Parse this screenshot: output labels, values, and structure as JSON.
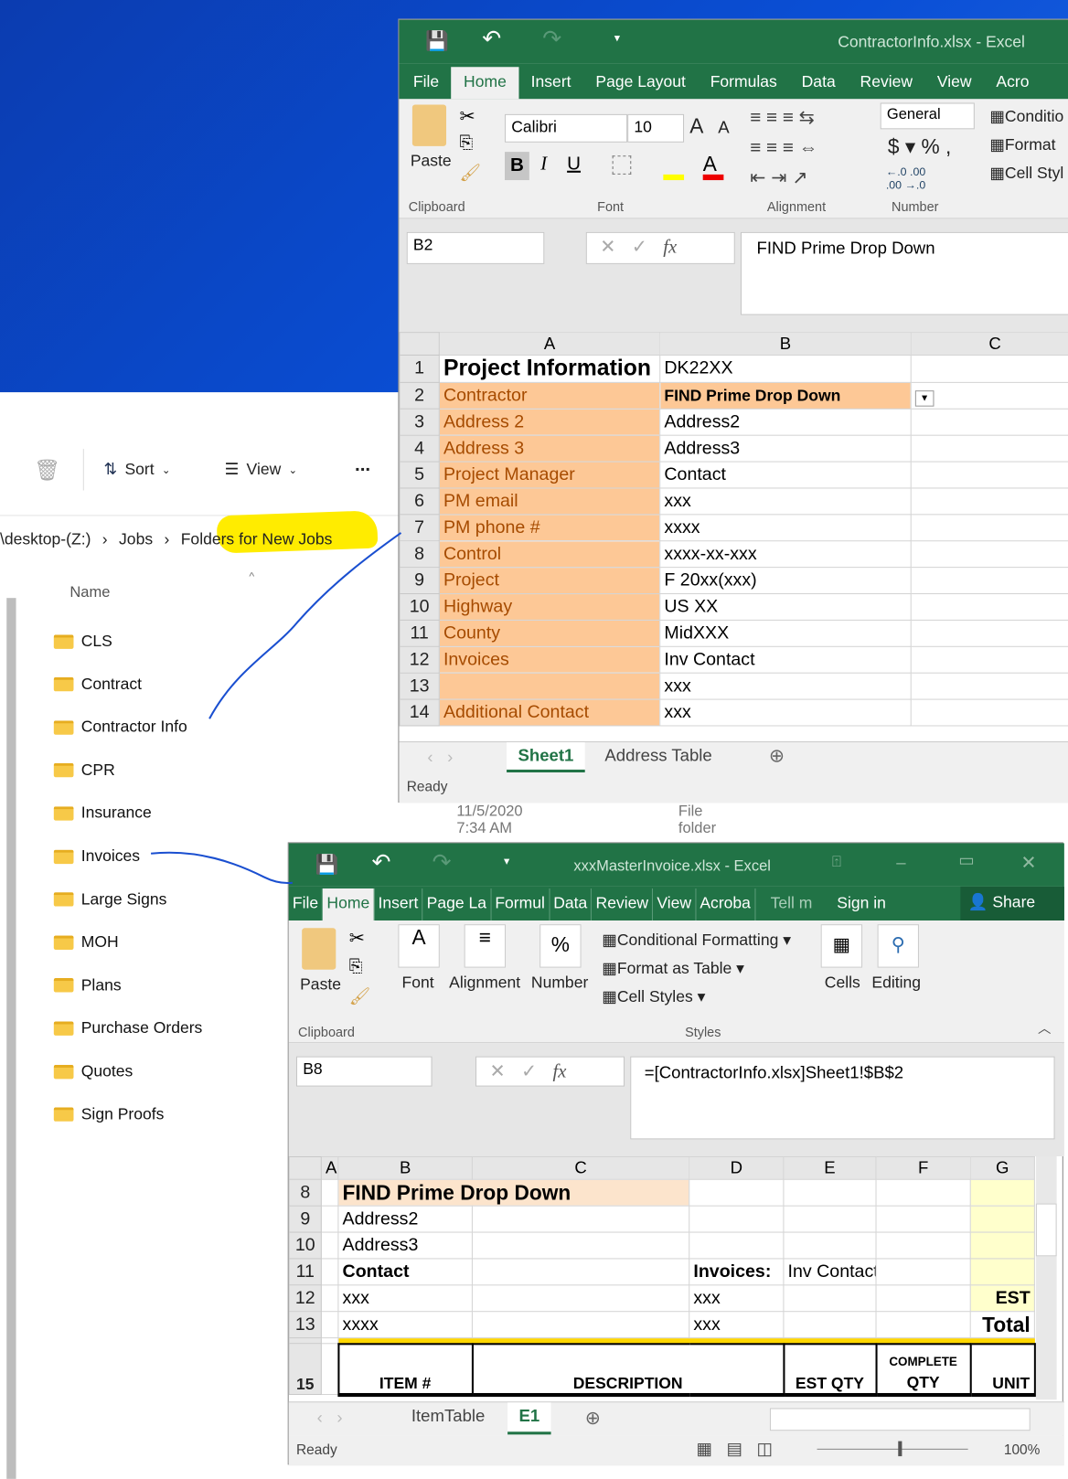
{
  "explorer": {
    "toolbar": {
      "sort": "Sort",
      "view": "View",
      "more": "..."
    },
    "breadcrumb": [
      "\\desktop-(Z:)",
      "Jobs",
      "Folders for New Jobs"
    ],
    "column_name": "Name",
    "folders": [
      "CLS",
      "Contract",
      "Contractor Info",
      "CPR",
      "Insurance",
      "Invoices",
      "Large Signs",
      "MOH",
      "Plans",
      "Purchase Orders",
      "Quotes",
      "Sign Proofs"
    ],
    "detail_date": "11/5/2020 7:34 AM",
    "detail_type": "File folder"
  },
  "excel1": {
    "title": "ContractorInfo.xlsx - Excel",
    "tabs": [
      "File",
      "Home",
      "Insert",
      "Page Layout",
      "Formulas",
      "Data",
      "Review",
      "View",
      "Acro"
    ],
    "ribbon": {
      "paste": "Paste",
      "font_name": "Calibri",
      "font_size": "10",
      "number_format": "General",
      "conditional": "Conditio",
      "format": "Format",
      "cell_styles": "Cell Styl",
      "groups": [
        "Clipboard",
        "Font",
        "Alignment",
        "Number"
      ]
    },
    "name_box": "B2",
    "formula": "FIND Prime Drop Down",
    "columns": [
      "A",
      "B",
      "C"
    ],
    "rows": [
      [
        "1",
        "Project Information",
        "DK22XX"
      ],
      [
        "2",
        "Contractor",
        "FIND Prime Drop Down"
      ],
      [
        "3",
        "Address 2",
        "Address2"
      ],
      [
        "4",
        "Address 3",
        "Address3"
      ],
      [
        "5",
        "Project Manager",
        "Contact"
      ],
      [
        "6",
        "PM email",
        "xxx"
      ],
      [
        "7",
        "PM phone #",
        "xxxx"
      ],
      [
        "8",
        "Control",
        "xxxx-xx-xxx"
      ],
      [
        "9",
        "Project",
        "F 20xx(xxx)"
      ],
      [
        "10",
        "Highway",
        "US XX"
      ],
      [
        "11",
        "County",
        "MidXXX"
      ],
      [
        "12",
        "Invoices",
        "Inv Contact"
      ],
      [
        "13",
        "",
        "xxx"
      ],
      [
        "14",
        "Additional Contact",
        "xxx"
      ]
    ],
    "sheets": [
      "Sheet1",
      "Address Table"
    ],
    "status": "Ready"
  },
  "excel2": {
    "title": "xxxMasterInvoice.xlsx - Excel",
    "tabs": [
      "File",
      "Home",
      "Insert",
      "Page La",
      "Formul",
      "Data",
      "Review",
      "View",
      "Acroba"
    ],
    "tell": "Tell m",
    "sign_in": "Sign in",
    "share": "Share",
    "ribbon": {
      "paste": "Paste",
      "font": "Font",
      "alignment": "Alignment",
      "number": "Number",
      "conditional": "Conditional Formatting",
      "format_table": "Format as Table",
      "cell_styles": "Cell Styles",
      "cells": "Cells",
      "editing": "Editing",
      "clipboard": "Clipboard",
      "styles": "Styles"
    },
    "name_box": "B8",
    "formula": "=[ContractorInfo.xlsx]Sheet1!$B$2",
    "columns": [
      "A",
      "B",
      "C",
      "D",
      "E",
      "F",
      "G"
    ],
    "rows": [
      {
        "n": "8",
        "b": "FIND Prime Drop Down",
        "d": "",
        "e": "",
        "g": ""
      },
      {
        "n": "9",
        "b": "Address2",
        "d": "",
        "e": "",
        "g": ""
      },
      {
        "n": "10",
        "b": "Address3",
        "d": "",
        "e": "",
        "g": ""
      },
      {
        "n": "11",
        "b": "Contact",
        "d": "Invoices:",
        "e": "Inv Contact",
        "g": ""
      },
      {
        "n": "12",
        "b": "xxx",
        "d": "xxx",
        "e": "",
        "g": "EST"
      },
      {
        "n": "13",
        "b": "xxxx",
        "d": "xxx",
        "e": "",
        "g": "Total"
      }
    ],
    "header_row": {
      "n": "15",
      "item": "ITEM #",
      "desc": "DESCRIPTION",
      "est": "EST QTY",
      "complete_top": "COMPLETE",
      "complete": "QTY",
      "unit": "UNIT"
    },
    "sheets": [
      "ItemTable",
      "E1"
    ],
    "status": "Ready",
    "zoom": "100%"
  }
}
